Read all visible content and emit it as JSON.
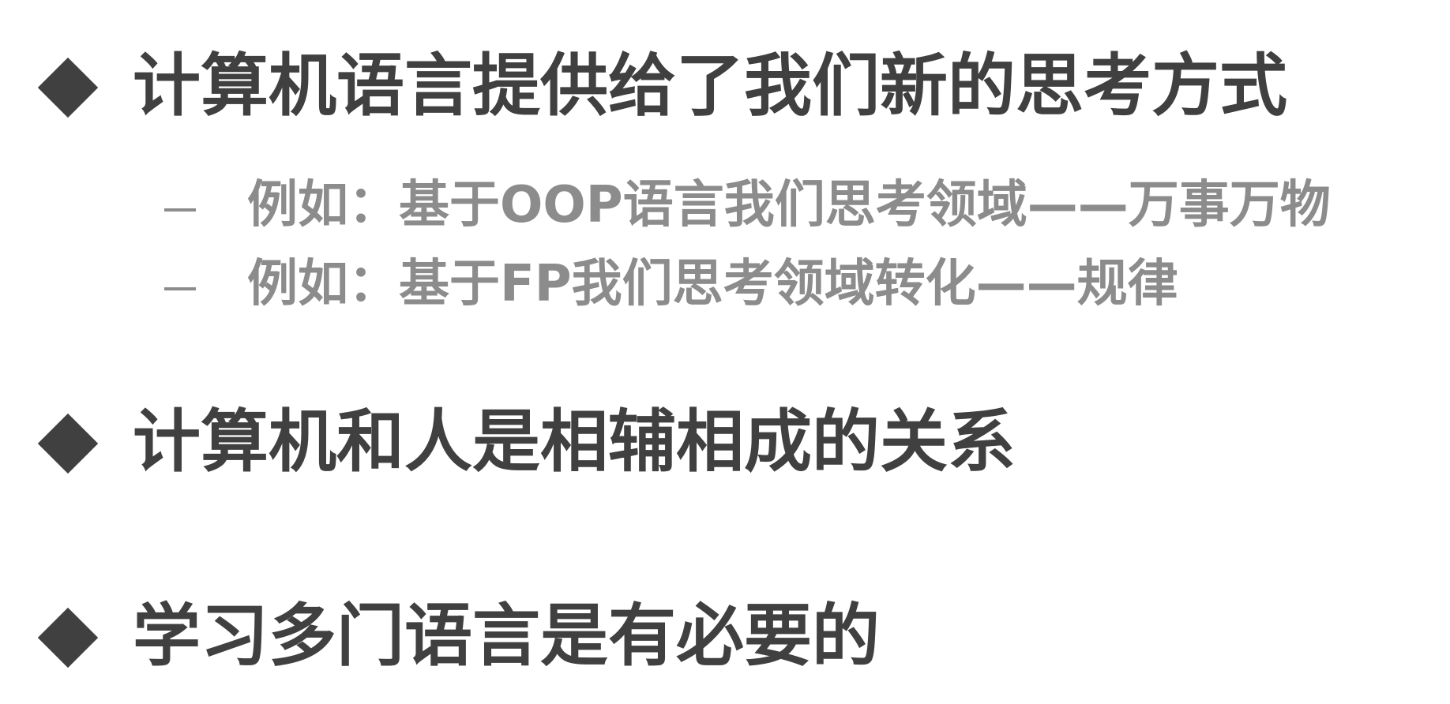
{
  "slide": {
    "points": [
      {
        "text": "计算机语言提供给了我们新的思考方式",
        "subpoints": [
          {
            "marker": "–",
            "text": "例如：基于OOP语言我们思考领域——万事万物"
          },
          {
            "marker": "–",
            "text": "例如：基于FP我们思考领域转化——规律"
          }
        ]
      },
      {
        "text": "计算机和人是相辅相成的关系"
      },
      {
        "text": "学习多门语言是有必要的"
      }
    ],
    "colors": {
      "main_text": "#404040",
      "sub_text": "#8c8c8c",
      "background": "#ffffff"
    },
    "icons": {
      "main_bullet": "diamond-icon",
      "sub_bullet": "dash-icon"
    }
  }
}
